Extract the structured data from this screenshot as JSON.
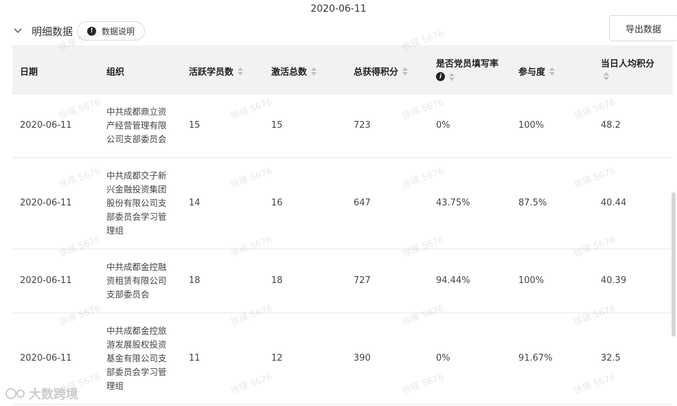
{
  "date_title": "2020-06-11",
  "section": {
    "title": "明细数据",
    "explain_label": "数据说明"
  },
  "export_label": "导出数据",
  "columns": [
    "日期",
    "组织",
    "活跃学员数",
    "激活总数",
    "总获得积分",
    "是否党员填写率",
    "参与度",
    "当日人均积分"
  ],
  "rows": [
    {
      "date": "2020-06-11",
      "org": "中共成都鼎立资产经营管理有限公司支部委员会",
      "active": "15",
      "activated": "15",
      "points": "723",
      "fill_rate": "0%",
      "participation": "100%",
      "avg_points": "48.2"
    },
    {
      "date": "2020-06-11",
      "org": "中共成都交子新兴金融投资集团股份有限公司支部委员会学习管理组",
      "active": "14",
      "activated": "16",
      "points": "647",
      "fill_rate": "43.75%",
      "participation": "87.5%",
      "avg_points": "40.44"
    },
    {
      "date": "2020-06-11",
      "org": "中共成都金控融资租赁有限公司支部委员会",
      "active": "18",
      "activated": "18",
      "points": "727",
      "fill_rate": "94.44%",
      "participation": "100%",
      "avg_points": "40.39"
    },
    {
      "date": "2020-06-11",
      "org": "中共成都金控旅游发展股权投资基金有限公司支部委员会学习管理组",
      "active": "11",
      "activated": "12",
      "points": "390",
      "fill_rate": "0%",
      "participation": "91.67%",
      "avg_points": "32.5"
    }
  ],
  "watermark_text": "徐瑛 5676",
  "brand_text": "大数跨境",
  "icons": {
    "collapse": "chevron-down-icon",
    "info": "info-icon",
    "sort": "sort-icon"
  }
}
